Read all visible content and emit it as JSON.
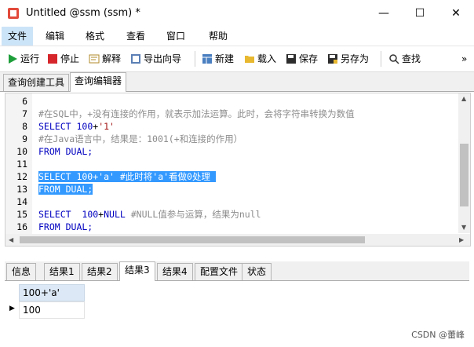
{
  "window": {
    "title": "Untitled @ssm (ssm) *",
    "minimize": "—",
    "maximize": "☐",
    "close": "✕"
  },
  "menu": [
    "文件",
    "编辑",
    "格式",
    "查看",
    "窗口",
    "帮助"
  ],
  "toolbar": {
    "run": "运行",
    "stop": "停止",
    "explain": "解释",
    "export": "导出向导",
    "new": "新建",
    "load": "载入",
    "save": "保存",
    "save_as": "另存为",
    "find": "查找",
    "overflow": "»"
  },
  "tabs": [
    "查询创建工具",
    "查询编辑器"
  ],
  "editor": {
    "lines": [
      {
        "n": "6",
        "segments": []
      },
      {
        "n": "7",
        "segments": [
          {
            "t": "#在SQL中，+没有连接的作用，就表示加法运算。此时，会将字符串转换为数值",
            "c": "cm"
          }
        ]
      },
      {
        "n": "8",
        "segments": [
          {
            "t": "SELECT ",
            "c": "kw"
          },
          {
            "t": "100",
            "c": "kw"
          },
          {
            "t": "+",
            "c": ""
          },
          {
            "t": "'1'",
            "c": "str"
          }
        ]
      },
      {
        "n": "9",
        "segments": [
          {
            "t": "#在Java语言中，结果是：1001(+和连接的作用）",
            "c": "cm"
          }
        ]
      },
      {
        "n": "10",
        "segments": [
          {
            "t": "FROM DUAL;",
            "c": "kw"
          }
        ]
      },
      {
        "n": "11",
        "segments": []
      },
      {
        "n": "12",
        "segments": [
          {
            "t": "SELECT 100+'a' #此时将'a'看做0处理 ",
            "c": "sel"
          }
        ]
      },
      {
        "n": "13",
        "segments": [
          {
            "t": "FROM DUAL;",
            "c": "sel"
          }
        ]
      },
      {
        "n": "14",
        "segments": []
      },
      {
        "n": "15",
        "segments": [
          {
            "t": "SELECT  ",
            "c": "kw"
          },
          {
            "t": "100",
            "c": "kw"
          },
          {
            "t": "+",
            "c": ""
          },
          {
            "t": "NULL ",
            "c": "kw"
          },
          {
            "t": "#NULL值参与运算，结果为null",
            "c": "cm"
          }
        ]
      },
      {
        "n": "16",
        "segments": [
          {
            "t": "FROM DUAL;",
            "c": "kw"
          }
        ]
      }
    ]
  },
  "result_tabs": [
    "信息",
    "结果1",
    "结果2",
    "结果3",
    "结果4",
    "配置文件",
    "状态"
  ],
  "active_result_tab": 3,
  "grid": {
    "column": "100+'a'",
    "value": "100",
    "row_marker": "▶"
  },
  "watermark": "CSDN @蕾峰"
}
